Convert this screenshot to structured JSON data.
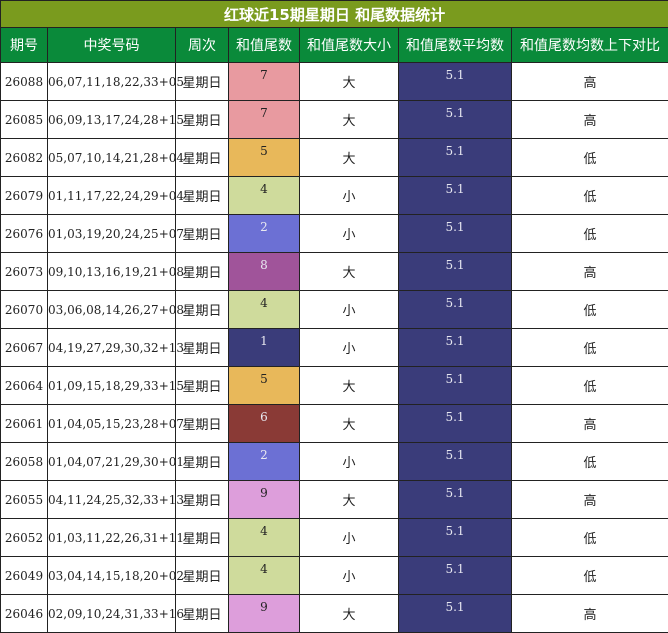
{
  "title": "红球近15期星期日 和尾数据统计",
  "headers": [
    "期号",
    "中奖号码",
    "周次",
    "和值尾数",
    "和值尾数大小",
    "和值尾数平均数",
    "和值尾数均数上下对比"
  ],
  "tail_colors": {
    "1": "#3a3c7a",
    "2": "#6c70d4",
    "4": "#cfdb9c",
    "5": "#e8b85a",
    "6": "#8a3a36",
    "7": "#e89aa0",
    "8": "#a0549a",
    "9": "#dd9edb"
  },
  "rows": [
    {
      "period": "26088",
      "numbers": "06,07,11,18,22,33+05",
      "weekday": "星期日",
      "tail": "7",
      "size": "大",
      "avg": "5.1",
      "compare": "高"
    },
    {
      "period": "26085",
      "numbers": "06,09,13,17,24,28+15",
      "weekday": "星期日",
      "tail": "7",
      "size": "大",
      "avg": "5.1",
      "compare": "高"
    },
    {
      "period": "26082",
      "numbers": "05,07,10,14,21,28+04",
      "weekday": "星期日",
      "tail": "5",
      "size": "大",
      "avg": "5.1",
      "compare": "低"
    },
    {
      "period": "26079",
      "numbers": "01,11,17,22,24,29+04",
      "weekday": "星期日",
      "tail": "4",
      "size": "小",
      "avg": "5.1",
      "compare": "低"
    },
    {
      "period": "26076",
      "numbers": "01,03,19,20,24,25+07",
      "weekday": "星期日",
      "tail": "2",
      "size": "小",
      "avg": "5.1",
      "compare": "低"
    },
    {
      "period": "26073",
      "numbers": "09,10,13,16,19,21+08",
      "weekday": "星期日",
      "tail": "8",
      "size": "大",
      "avg": "5.1",
      "compare": "高"
    },
    {
      "period": "26070",
      "numbers": "03,06,08,14,26,27+08",
      "weekday": "星期日",
      "tail": "4",
      "size": "小",
      "avg": "5.1",
      "compare": "低"
    },
    {
      "period": "26067",
      "numbers": "04,19,27,29,30,32+13",
      "weekday": "星期日",
      "tail": "1",
      "size": "小",
      "avg": "5.1",
      "compare": "低"
    },
    {
      "period": "26064",
      "numbers": "01,09,15,18,29,33+15",
      "weekday": "星期日",
      "tail": "5",
      "size": "大",
      "avg": "5.1",
      "compare": "低"
    },
    {
      "period": "26061",
      "numbers": "01,04,05,15,23,28+07",
      "weekday": "星期日",
      "tail": "6",
      "size": "大",
      "avg": "5.1",
      "compare": "高"
    },
    {
      "period": "26058",
      "numbers": "01,04,07,21,29,30+01",
      "weekday": "星期日",
      "tail": "2",
      "size": "小",
      "avg": "5.1",
      "compare": "低"
    },
    {
      "period": "26055",
      "numbers": "04,11,24,25,32,33+13",
      "weekday": "星期日",
      "tail": "9",
      "size": "大",
      "avg": "5.1",
      "compare": "高"
    },
    {
      "period": "26052",
      "numbers": "01,03,11,22,26,31+11",
      "weekday": "星期日",
      "tail": "4",
      "size": "小",
      "avg": "5.1",
      "compare": "低"
    },
    {
      "period": "26049",
      "numbers": "03,04,14,15,18,20+02",
      "weekday": "星期日",
      "tail": "4",
      "size": "小",
      "avg": "5.1",
      "compare": "低"
    },
    {
      "period": "26046",
      "numbers": "02,09,10,24,31,33+16",
      "weekday": "星期日",
      "tail": "9",
      "size": "大",
      "avg": "5.1",
      "compare": "高"
    }
  ]
}
